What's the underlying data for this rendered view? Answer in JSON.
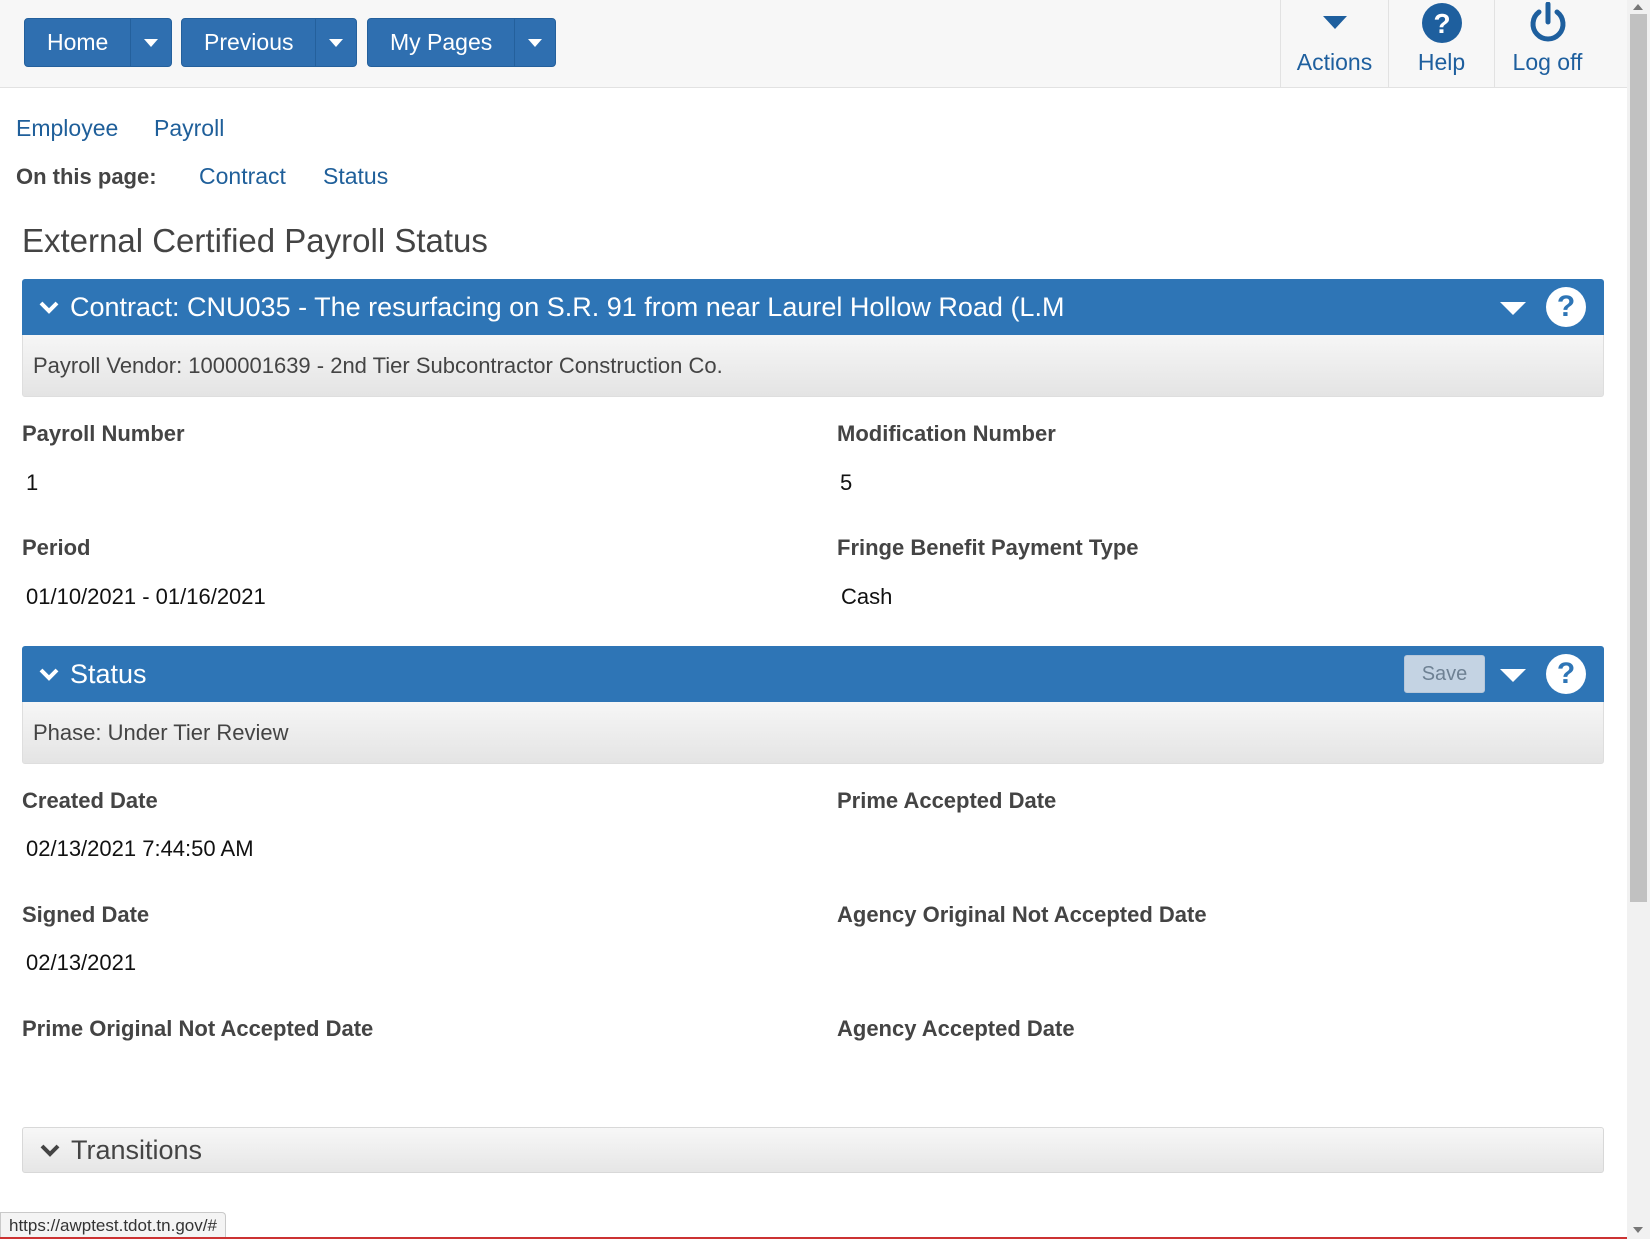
{
  "topnav": {
    "home_label": "Home",
    "previous_label": "Previous",
    "mypages_label": "My Pages"
  },
  "toolbar": {
    "actions_label": "Actions",
    "help_label": "Help",
    "logoff_label": "Log off"
  },
  "breadcrumbs": [
    "Employee",
    "Payroll"
  ],
  "onpage": {
    "label": "On this page:",
    "links": [
      "Contract",
      "Status"
    ]
  },
  "page_title": "External Certified Payroll Status",
  "contract_panel": {
    "title": "Contract: CNU035 - The resurfacing on S.R. 91 from near Laurel Hollow Road (L.M",
    "subtitle": "Payroll Vendor: 1000001639 - 2nd Tier Subcontractor Construction Co."
  },
  "contract_fields": {
    "payroll_number": {
      "label": "Payroll Number",
      "value": "1"
    },
    "modification_number": {
      "label": "Modification Number",
      "value": "5"
    },
    "period": {
      "label": "Period",
      "value": "01/10/2021 - 01/16/2021"
    },
    "fringe": {
      "label": "Fringe Benefit Payment Type",
      "value": "Cash"
    }
  },
  "status_panel": {
    "title": "Status",
    "save_label": "Save",
    "subtitle": "Phase: Under Tier Review"
  },
  "status_fields": {
    "created_date": {
      "label": "Created Date",
      "value": "02/13/2021 7:44:50 AM"
    },
    "prime_accepted_date": {
      "label": "Prime Accepted Date",
      "value": ""
    },
    "signed_date": {
      "label": "Signed Date",
      "value": "02/13/2021"
    },
    "agency_original_not_accepted_date": {
      "label": "Agency Original Not Accepted Date",
      "value": ""
    },
    "prime_original_not_accepted_date": {
      "label": "Prime Original Not Accepted Date",
      "value": ""
    },
    "agency_accepted_date": {
      "label": "Agency Accepted Date",
      "value": ""
    }
  },
  "transitions_panel": {
    "title": "Transitions"
  },
  "status_url": "https://awptest.tdot.tn.gov/#",
  "colors": {
    "primary": "#2e75b6",
    "link": "#1f5f9a"
  }
}
